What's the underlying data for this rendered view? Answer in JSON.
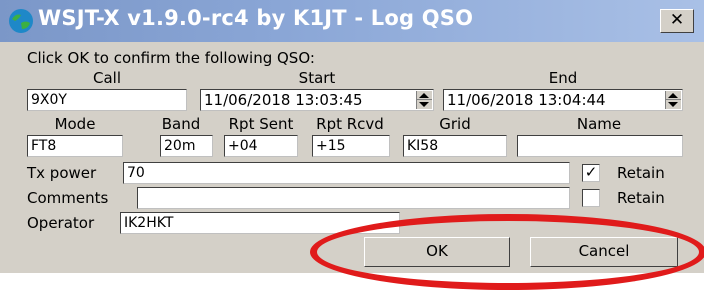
{
  "window": {
    "title": "WSJT-X   v1.9.0-rc4   by K1JT - Log QSO",
    "close_symbol": "✕"
  },
  "prompt": "Click OK to confirm the following QSO:",
  "headers": {
    "call": "Call",
    "start": "Start",
    "end": "End",
    "mode": "Mode",
    "band": "Band",
    "rpt_sent": "Rpt Sent",
    "rpt_rcvd": "Rpt Rcvd",
    "grid": "Grid",
    "name": "Name"
  },
  "values": {
    "call": "9X0Y",
    "start": "11/06/2018 13:03:45",
    "end": "11/06/2018 13:04:44",
    "mode": "FT8",
    "band": "20m",
    "rpt_sent": "+04",
    "rpt_rcvd": "+15",
    "grid": "KI58",
    "name": ""
  },
  "tx_power": {
    "label": "Tx power",
    "value": "70",
    "retain_label": "Retain",
    "retain_checked": true,
    "check_mark": "✓"
  },
  "comments": {
    "label": "Comments",
    "value": "",
    "retain_label": "Retain",
    "retain_checked": false
  },
  "operator": {
    "label": "Operator",
    "value": "IK2HKT"
  },
  "buttons": {
    "ok": "OK",
    "cancel": "Cancel"
  },
  "colors": {
    "dialog_bg": "#d4d0c8",
    "titlebar": "#8aa6d6",
    "annotation": "#e01b1b"
  }
}
